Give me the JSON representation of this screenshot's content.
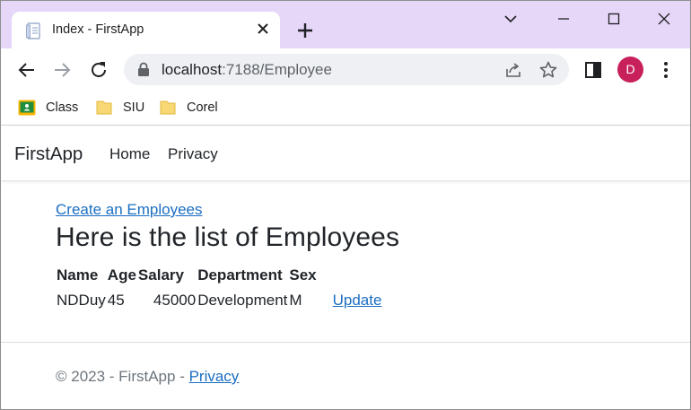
{
  "browser": {
    "tab_title": "Index - FirstApp",
    "url_host": "localhost",
    "url_path": ":7188/Employee",
    "profile_initial": "D",
    "profile_color": "#c8205a",
    "bookmarks": [
      {
        "label": "Class",
        "icon": "classroom-icon"
      },
      {
        "label": "SIU",
        "icon": "folder-icon"
      },
      {
        "label": "Corel",
        "icon": "folder-icon"
      }
    ]
  },
  "app": {
    "brand": "FirstApp",
    "nav": [
      "Home",
      "Privacy"
    ],
    "create_link": "Create an Employees",
    "heading": "Here is the list of Employees",
    "table": {
      "headers": [
        "Name",
        "Age",
        "Salary",
        "Department",
        "Sex"
      ],
      "rows": [
        {
          "name": "NDDuy",
          "age": "45",
          "salary": "45000",
          "department": "Development",
          "sex": "M",
          "action": "Update"
        }
      ]
    },
    "footer": {
      "text": "© 2023 - FirstApp - ",
      "link": "Privacy"
    },
    "link_color": "#1b6ec2"
  }
}
